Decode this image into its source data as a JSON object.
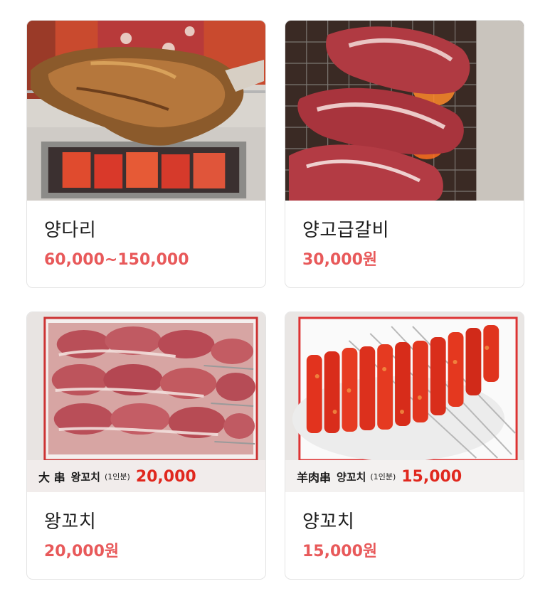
{
  "menu": {
    "items": [
      {
        "name": "양다리",
        "price": "60,000~150,000",
        "photo": "roasted-lamb-leg"
      },
      {
        "name": "양고급갈비",
        "price": "30,000원",
        "photo": "raw-lamb-ribs-on-grill"
      },
      {
        "name": "왕꼬치",
        "price": "20,000원",
        "photo": "large-lamb-skewers",
        "sign": {
          "hanja": "大 串",
          "korean": "왕꼬치",
          "serving": "(1인분)",
          "price": "20,000"
        }
      },
      {
        "name": "양꼬치",
        "price": "15,000원",
        "photo": "spiced-lamb-skewers",
        "sign": {
          "hanja": "羊肉串",
          "korean": "양꼬치",
          "serving": "(1인분)",
          "price": "15,000"
        }
      }
    ]
  },
  "colors": {
    "price": "#e8595a",
    "sign_price": "#e0281e",
    "card_border": "#e4e4e4"
  }
}
